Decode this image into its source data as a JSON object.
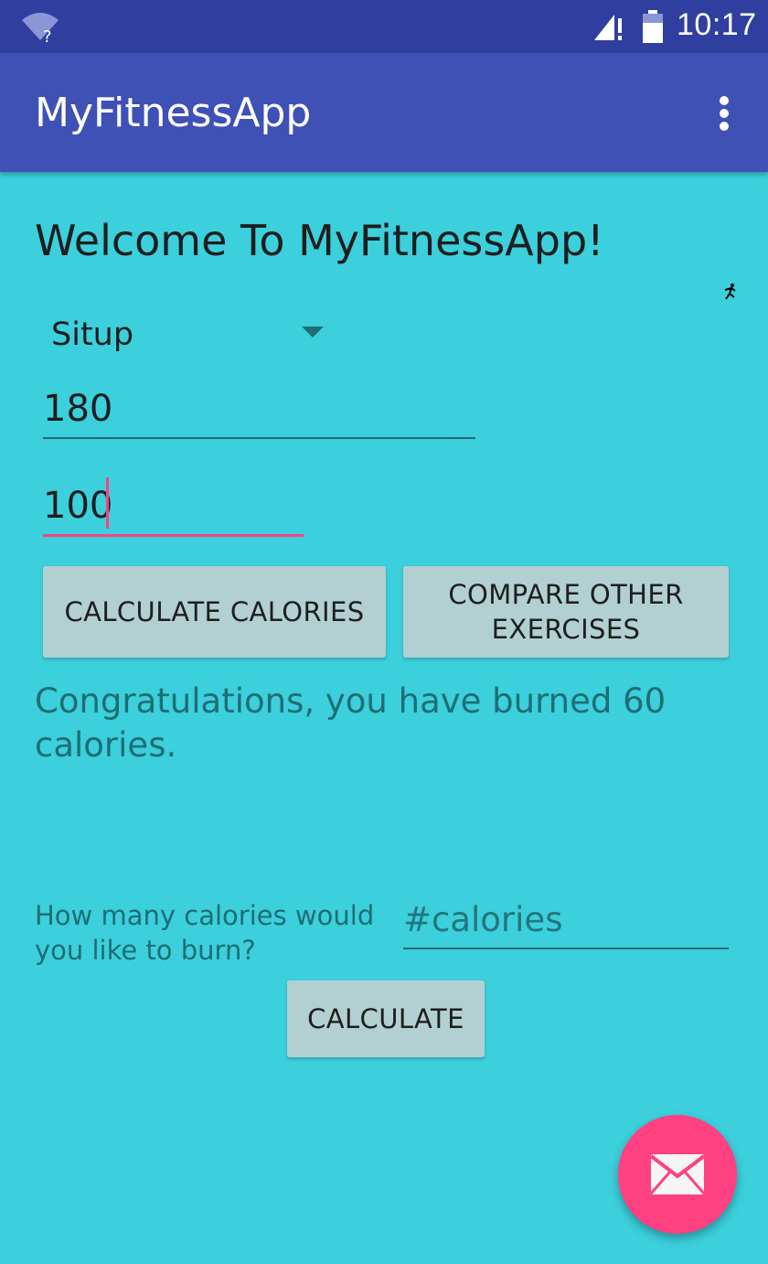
{
  "status_bar": {
    "time": "10:17",
    "icons": [
      "wifi-unknown-icon",
      "signal-icon",
      "battery-icon"
    ],
    "background": "#303f9f"
  },
  "app_bar": {
    "title": "MyFitnessApp",
    "menu_icon": "more-vert-icon",
    "background": "#3f51b5"
  },
  "main": {
    "welcome": "Welcome To MyFitnessApp!",
    "exercise_select": {
      "selected": "Situp"
    },
    "weight_input": {
      "value": "180"
    },
    "reps_input": {
      "value": "100"
    },
    "calculate_calories_label": "CALCULATE CALORIES",
    "compare_label": "COMPARE OTHER EXERCISES",
    "result": "Congratulations, you have burned 60 calories.",
    "question": "How many calories would you like to burn?",
    "calories_input": {
      "placeholder": "#calories",
      "value": ""
    },
    "calculate_label": "CALCULATE",
    "background": "#3ccfdc",
    "accent": "#ff4081"
  },
  "fab": {
    "icon": "email-icon"
  }
}
